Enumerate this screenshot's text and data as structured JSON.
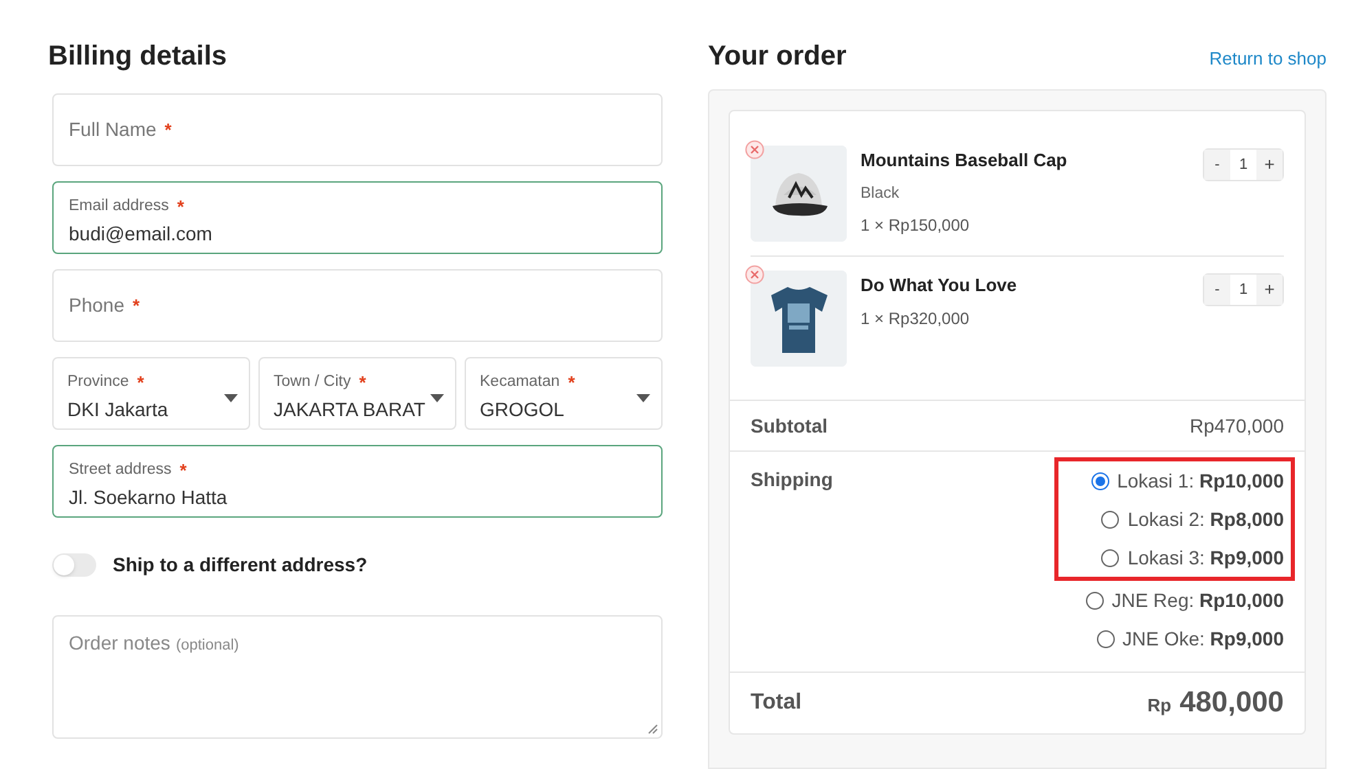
{
  "billing": {
    "title": "Billing details",
    "fields": [
      {
        "kind": "text",
        "label": "Full Name",
        "required_mark": "*",
        "focused": false
      },
      {
        "kind": "text",
        "label": "Email address",
        "required_mark": "*",
        "value": "budi@email.com",
        "focused": true
      },
      {
        "kind": "text",
        "label": "Phone",
        "required_mark": "*",
        "focused": false
      },
      {
        "kind": "selects",
        "items": [
          {
            "label": "Province",
            "required_mark": "*",
            "value": "DKI Jakarta"
          },
          {
            "label": "Town / City",
            "required_mark": "*",
            "value": "JAKARTA BARAT"
          },
          {
            "label": "Kecamatan",
            "required_mark": "*",
            "value": "GROGOL"
          }
        ]
      },
      {
        "kind": "text",
        "label": "Street address",
        "required_mark": "*",
        "value": "Jl. Soekarno Hatta",
        "focused": true
      }
    ],
    "ship_toggle": {
      "label": "Ship to a different address?",
      "on": false
    },
    "notes": {
      "label": "Order notes",
      "optional_text": "(optional)"
    }
  },
  "order": {
    "title": "Your order",
    "return_link": "Return to shop",
    "items": [
      {
        "name": "Mountains Baseball Cap",
        "variant": "Black",
        "price": "1 × Rp150,000",
        "quantity": "1",
        "minus": "-",
        "plus": "+"
      },
      {
        "name": "Do What You Love",
        "price": "1 × Rp320,000",
        "quantity": "1",
        "minus": "-",
        "plus": "+"
      }
    ],
    "subtotal_label": "Subtotal",
    "subtotal": "Rp470,000",
    "shipping_label": "Shipping",
    "shipping_groups": [
      {
        "highlighted": true,
        "options": [
          {
            "name": "Lokasi 1:",
            "price": "Rp10,000",
            "selected": true
          },
          {
            "name": "Lokasi 2:",
            "price": "Rp8,000",
            "selected": false
          },
          {
            "name": "Lokasi 3:",
            "price": "Rp9,000",
            "selected": false
          }
        ]
      },
      {
        "highlighted": false,
        "options": [
          {
            "name": "JNE Reg:",
            "price": "Rp10,000",
            "selected": false
          },
          {
            "name": "JNE Oke:",
            "price": "Rp9,000",
            "selected": false
          }
        ]
      }
    ],
    "total_label": "Total",
    "total_currency": "Rp",
    "total": "480,000"
  }
}
